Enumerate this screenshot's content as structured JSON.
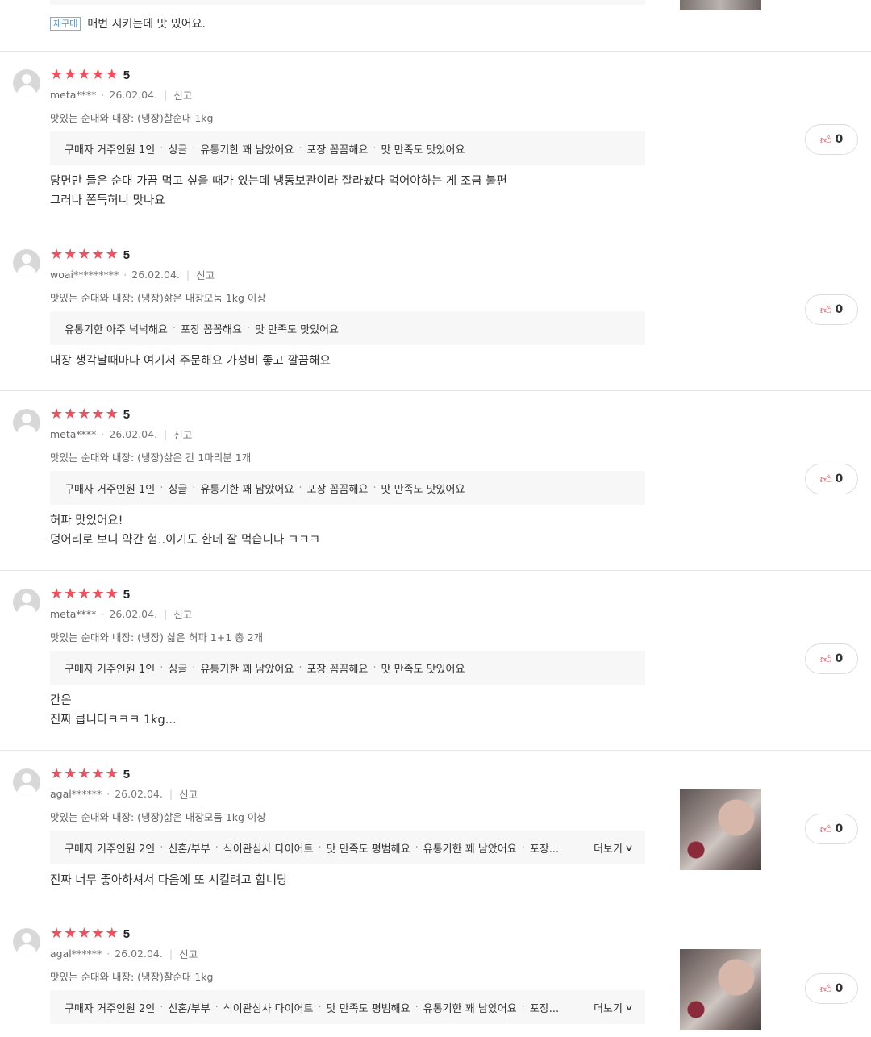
{
  "top": {
    "badge": "재구매",
    "text": "매번 시키는데 맛 있어요."
  },
  "reviews": [
    {
      "rating": "5",
      "user": "meta****",
      "date": "26.02.04.",
      "report": "신고",
      "option": "맛있는 순대와 내장: (냉장)찰순대 1kg",
      "tags": [
        "구매자 거주인원 1인",
        "싱글",
        "유통기한 꽤 남았어요",
        "포장 꼼꼼해요",
        "맛 만족도 맛있어요"
      ],
      "content": "당면만 들은 순대 가끔 먹고 싶을 때가 있는데 냉동보관이라 잘라놨다 먹어야하는 게 조금 불편\n그러나 쫀득허니 맛나요",
      "likes": "0"
    },
    {
      "rating": "5",
      "user": "woai*********",
      "date": "26.02.04.",
      "report": "신고",
      "option": "맛있는 순대와 내장: (냉장)삶은 내장모둠 1kg 이상",
      "tags": [
        "유통기한 아주 넉넉해요",
        "포장 꼼꼼해요",
        "맛 만족도 맛있어요"
      ],
      "content": "내장 생각날때마다 여기서 주문해요 가성비 좋고 깔끔해요",
      "likes": "0"
    },
    {
      "rating": "5",
      "user": "meta****",
      "date": "26.02.04.",
      "report": "신고",
      "option": "맛있는 순대와 내장: (냉장)삶은 간 1마리분 1개",
      "tags": [
        "구매자 거주인원 1인",
        "싱글",
        "유통기한 꽤 남았어요",
        "포장 꼼꼼해요",
        "맛 만족도 맛있어요"
      ],
      "content": "허파 맛있어요!\n덩어리로 보니 약간 험..이기도 한데 잘 먹습니다 ㅋㅋㅋ",
      "likes": "0"
    },
    {
      "rating": "5",
      "user": "meta****",
      "date": "26.02.04.",
      "report": "신고",
      "option": "맛있는 순대와 내장: (냉장) 삶은 허파 1+1 총 2개",
      "tags": [
        "구매자 거주인원 1인",
        "싱글",
        "유통기한 꽤 남았어요",
        "포장 꼼꼼해요",
        "맛 만족도 맛있어요"
      ],
      "content": "간은\n진짜 큽니다ㅋㅋㅋ 1kg...",
      "likes": "0"
    },
    {
      "rating": "5",
      "user": "agal******",
      "date": "26.02.04.",
      "report": "신고",
      "option": "맛있는 순대와 내장: (냉장)삶은 내장모둠 1kg 이상",
      "tags": [
        "구매자 거주인원 2인",
        "신혼/부부",
        "식이관심사 다이어트",
        "맛 만족도 평범해요",
        "유통기한 꽤 남았어요",
        "포장..."
      ],
      "more": "더보기",
      "content": "진짜 너무 좋아하셔서 다음에 또 시킬려고 합니당",
      "likes": "0"
    },
    {
      "rating": "5",
      "user": "agal******",
      "date": "26.02.04.",
      "report": "신고",
      "option": "맛있는 순대와 내장: (냉장)찰순대 1kg",
      "tags": [
        "구매자 거주인원 2인",
        "신혼/부부",
        "식이관심사 다이어트",
        "맛 만족도 평범해요",
        "유통기한 꽤 남았어요",
        "포장..."
      ],
      "more": "더보기",
      "content": "",
      "likes": "0"
    }
  ],
  "colors": {
    "star": "#f04f5d",
    "tagbg": "#f7f7f7",
    "border": "#e5e5e5"
  },
  "icons": {
    "star": "star-icon",
    "like": "thumbs-up-icon",
    "more": "chevron-down-icon",
    "avatar": "avatar-placeholder-icon"
  }
}
